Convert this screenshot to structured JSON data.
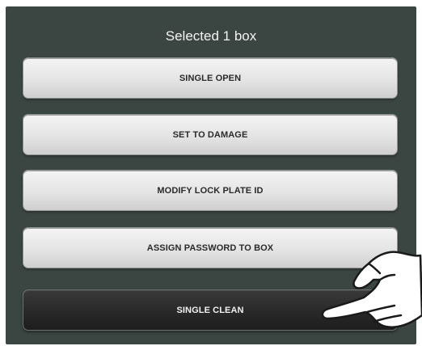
{
  "dialog": {
    "title": "Selected 1 box",
    "buttons": [
      {
        "label": "SINGLE OPEN"
      },
      {
        "label": "SET TO DAMAGE"
      },
      {
        "label": "MODIFY LOCK PLATE ID"
      },
      {
        "label": "ASSIGN PASSWORD TO BOX"
      },
      {
        "label": "SINGLE CLEAN"
      }
    ]
  },
  "colors": {
    "panel": "#3b4542",
    "button_light": "#e4e4e4",
    "button_pressed": "#2a2a2a"
  },
  "overlay": {
    "icon": "pointing-hand-icon"
  }
}
